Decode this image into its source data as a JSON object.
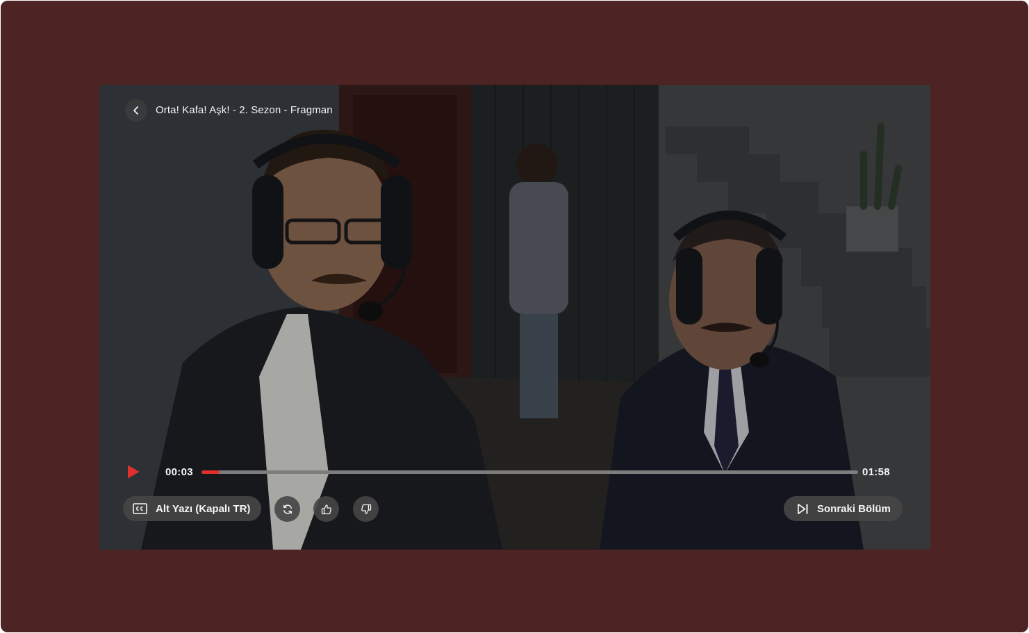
{
  "player": {
    "title": "Orta! Kafa! Aşk! - 2. Sezon - Fragman",
    "back_icon": "chevron-left-icon",
    "play_icon": "play-icon",
    "accent_color": "#e0302b",
    "current_time": "00:03",
    "total_time": "01:58",
    "progress_percent": 2.8,
    "subtitles_label": "Alt Yazı (Kapalı TR)",
    "subtitles_icon": "closed-captions-icon",
    "replay_icon": "refresh-icon",
    "like_icon": "thumbs-up-icon",
    "dislike_icon": "thumbs-down-icon",
    "next_episode_label": "Sonraki Bölüm",
    "next_episode_icon": "skip-next-icon"
  }
}
